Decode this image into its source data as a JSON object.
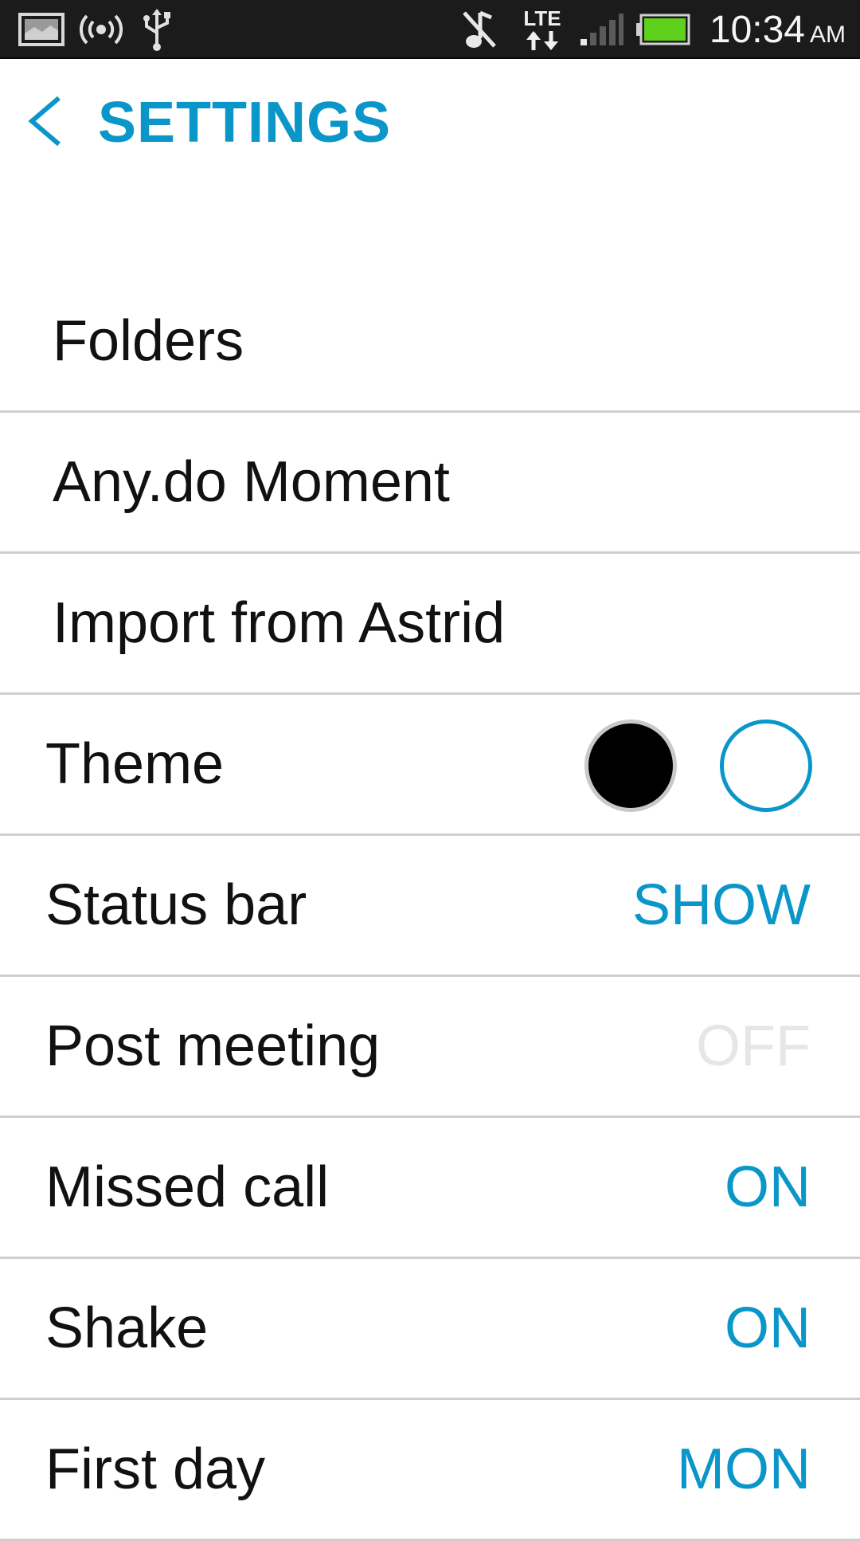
{
  "status_bar": {
    "time": "10:34",
    "ampm": "AM",
    "network": "LTE",
    "icons": [
      "image-notification-icon",
      "hotspot-icon",
      "usb-icon",
      "muted-music-icon",
      "lte-data-icon",
      "signal-icon",
      "battery-icon"
    ],
    "battery_color": "#5fd11c"
  },
  "header": {
    "title": "SETTINGS"
  },
  "settings": {
    "folders": {
      "label": "Folders"
    },
    "moment": {
      "label": "Any.do Moment"
    },
    "import": {
      "label": "Import from Astrid"
    },
    "theme": {
      "label": "Theme"
    },
    "status_bar": {
      "label": "Status bar",
      "value": "SHOW"
    },
    "post_meeting": {
      "label": "Post meeting",
      "value": "OFF"
    },
    "missed_call": {
      "label": "Missed call",
      "value": "ON"
    },
    "shake": {
      "label": "Shake",
      "value": "ON"
    },
    "first_day": {
      "label": "First day",
      "value": "MON"
    }
  },
  "colors": {
    "accent": "#0a96c8",
    "off_text": "#e6e6e6",
    "divider": "#cfcfcf"
  }
}
